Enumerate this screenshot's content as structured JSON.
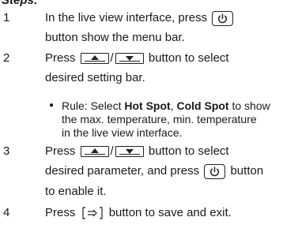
{
  "heading": "Steps:",
  "steps": [
    {
      "num": "1",
      "line1_a": "In the live view interface, press",
      "line2": "button show the menu bar."
    },
    {
      "num": "2",
      "line1_a": "Press",
      "line1_sep": "/",
      "line1_b": "button to select",
      "line2": "desired setting bar."
    },
    {
      "num": "3",
      "line1_a": "Press",
      "line1_sep": "/",
      "line1_b": "button to select",
      "line2_a": "desired parameter, and press",
      "line2_b": "button",
      "line3": "to enable it."
    },
    {
      "num": "4",
      "line1_a": "Press",
      "line1_b": "button to save and exit."
    }
  ],
  "rule": {
    "bullet": "●",
    "line1_a": "Rule: Select",
    "bold1": "Hot Spot",
    "comma": ",",
    "bold2": "Cold Spot",
    "line1_b": "to show",
    "line2": "the max. temperature, min. temperature",
    "line3": "in the live view interface."
  },
  "icons": {
    "power": "power-button-icon",
    "up": "up-arrow-button-icon",
    "down": "down-arrow-button-icon",
    "back": "back-exit-icon"
  }
}
